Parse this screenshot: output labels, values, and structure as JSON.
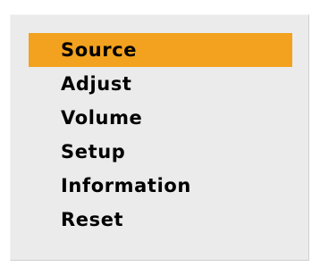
{
  "menu": {
    "items": [
      {
        "id": "source",
        "label": "Source",
        "selected": true
      },
      {
        "id": "adjust",
        "label": "Adjust",
        "selected": false
      },
      {
        "id": "volume",
        "label": "Volume",
        "selected": false
      },
      {
        "id": "setup",
        "label": "Setup",
        "selected": false
      },
      {
        "id": "information",
        "label": "Information",
        "selected": false
      },
      {
        "id": "reset",
        "label": "Reset",
        "selected": false
      }
    ]
  },
  "colors": {
    "panel_background": "#ebebeb",
    "selection_highlight": "#f2a21e",
    "text": "#000000",
    "page_background": "#ffffff"
  }
}
